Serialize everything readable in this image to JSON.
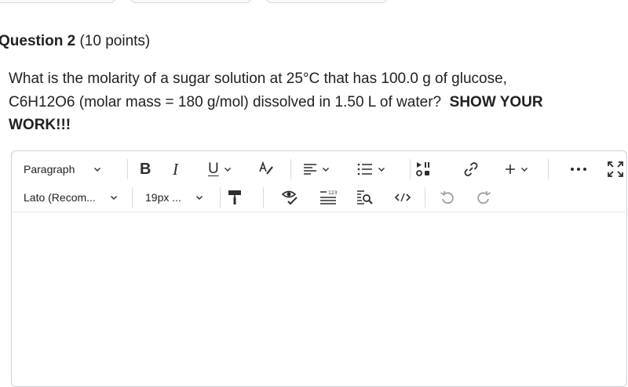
{
  "question": {
    "number_label": "Question 2",
    "points_label": "(10 points)",
    "text_line1": "What is the molarity of a sugar solution at 25°C that has 100.0 g of glucose,",
    "text_line2": "C6H12O6 (molar mass = 180 g/mol) dissolved in 1.50 L of water?",
    "emphasis_part1": "SHOW YOUR",
    "emphasis_part2": "WORK!!!"
  },
  "editor": {
    "block_format_value": "Paragraph",
    "font_family_value": "Lato (Recom...",
    "font_size_value": "19px ...",
    "content": ""
  },
  "icons": {
    "bold": "bold-icon",
    "italic": "italic-icon",
    "underline": "underline-icon",
    "format": "text-format-icon",
    "align": "align-left-icon",
    "list": "bulleted-list-icon",
    "media": "insert-media-icon",
    "link": "link-icon",
    "insert": "plus-icon",
    "more": "more-icon",
    "fullscreen": "fullscreen-icon",
    "paint": "format-painter-icon",
    "accessibility": "accessibility-checker-icon",
    "wordcount": "word-count-icon",
    "findreplace": "find-replace-icon",
    "source": "source-code-icon",
    "undo": "undo-icon",
    "redo": "redo-icon"
  }
}
